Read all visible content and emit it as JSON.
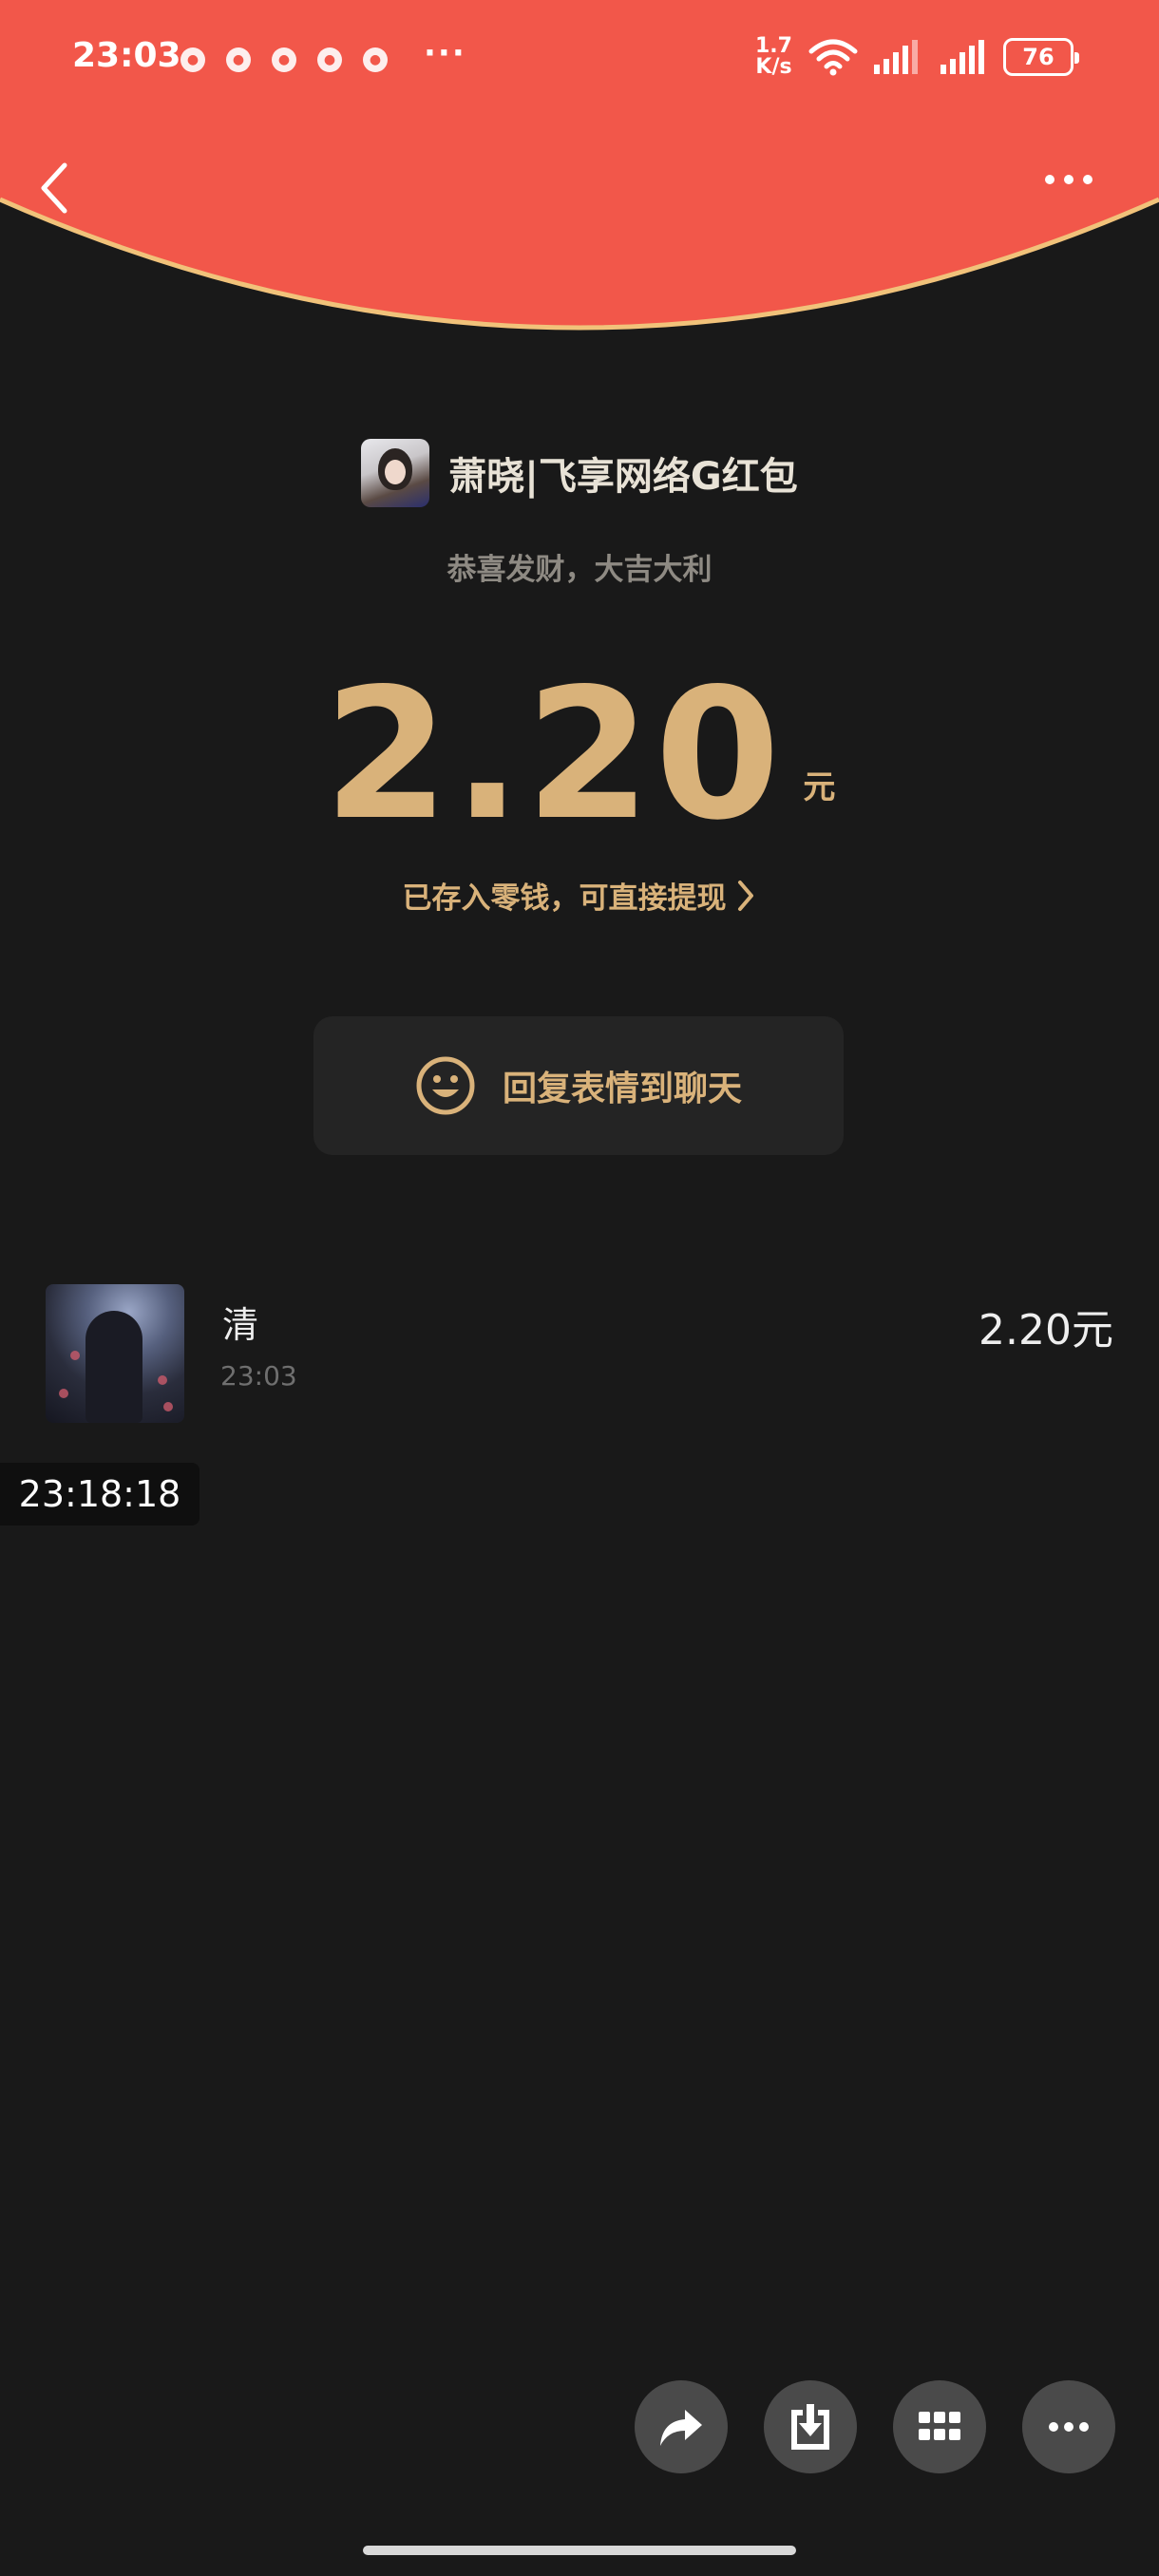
{
  "status_bar": {
    "time": "23:03",
    "net_speed_value": "1.7",
    "net_speed_unit": "K/s",
    "battery": "76"
  },
  "sender": {
    "name": "萧晓|飞享网络G红包",
    "blessing": "恭喜发财，大吉大利"
  },
  "amount": {
    "value": "2.20",
    "unit": "元",
    "deposit_note": "已存入零钱，可直接提现"
  },
  "reply_button": {
    "label": "回复表情到聊天"
  },
  "record": {
    "name": "清",
    "time": "23:03",
    "amount": "2.20元"
  },
  "overlay_timestamp": "23:18:18",
  "colors": {
    "header_red": "#f2574a",
    "gold": "#d9b27a",
    "background": "#191919"
  },
  "icons": [
    "back-icon",
    "more-icon",
    "smiley-icon",
    "share-icon",
    "download-icon",
    "grid-icon",
    "ellipsis-icon"
  ]
}
